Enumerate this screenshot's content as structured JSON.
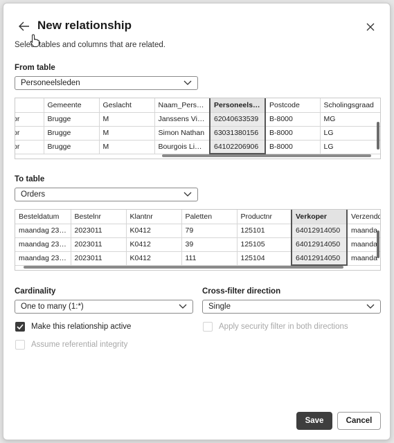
{
  "dialog": {
    "title": "New relationship",
    "subtitle": "Select tables and columns that are related."
  },
  "from_table": {
    "label": "From table",
    "selected": "Personeelsleden",
    "columns": [
      "",
      "Gemeente",
      "Geslacht",
      "Naam_Person...",
      "Personeelslid...",
      "Postcode",
      "Scholingsgraad"
    ],
    "rows": [
      [
        "or",
        "Brugge",
        "M",
        "Janssens Vinc...",
        "62040633539",
        "B-8000",
        "MG"
      ],
      [
        "or",
        "Brugge",
        "M",
        "Simon Nathan",
        "63031380156",
        "B-8000",
        "LG"
      ],
      [
        "or",
        "Brugge",
        "M",
        "Bourgois Liev...",
        "64102206906",
        "B-8000",
        "LG"
      ]
    ],
    "selected_column": "Personeelslid..."
  },
  "to_table": {
    "label": "To table",
    "selected": "Orders",
    "columns": [
      "Besteldatum",
      "Bestelnr",
      "Klantnr",
      "Paletten",
      "Productnr",
      "Verkoper",
      "Verzenddat"
    ],
    "rows": [
      [
        "maandag 23 j...",
        "2023011",
        "K0412",
        "79",
        "125101",
        "64012914050",
        "maanda"
      ],
      [
        "maandag 23 j...",
        "2023011",
        "K0412",
        "39",
        "125105",
        "64012914050",
        "maanda"
      ],
      [
        "maandag 23 j...",
        "2023011",
        "K0412",
        "111",
        "125104",
        "64012914050",
        "maanda"
      ]
    ],
    "selected_column": "Verkoper"
  },
  "cardinality": {
    "label": "Cardinality",
    "selected": "One to many (1:*)"
  },
  "cross_filter": {
    "label": "Cross-filter direction",
    "selected": "Single"
  },
  "options": {
    "make_active": {
      "label": "Make this relationship active",
      "checked": true
    },
    "referential_integrity": {
      "label": "Assume referential integrity",
      "checked": false
    },
    "security_filter": {
      "label": "Apply security filter in both directions",
      "checked": false
    }
  },
  "buttons": {
    "save": "Save",
    "cancel": "Cancel"
  },
  "icons": {
    "back": "back-arrow-icon",
    "close": "close-icon",
    "cursor": "mouse-pointer-icon",
    "dropdown": "chevron-down-icon",
    "check": "checkmark-icon"
  },
  "colors": {
    "primary_button": "#3e3e3e",
    "selected_column_bg": "#ebebeb",
    "disabled_text": "#a8a8a8"
  }
}
